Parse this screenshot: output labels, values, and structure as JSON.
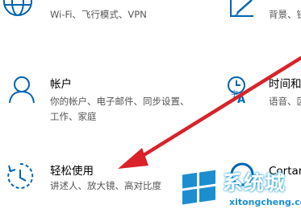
{
  "tiles": {
    "network": {
      "desc": "Wi-Fi、飞行模式、VPN",
      "icon": "globe-icon"
    },
    "personalization": {
      "desc": "背景、锁屏、颜",
      "icon": "pen-tablet-icon"
    },
    "accounts": {
      "title": "帐户",
      "desc_line1": "你的帐户、电子邮件、同步设置、",
      "desc_line2": "工作、家庭",
      "icon": "person-icon"
    },
    "time_language": {
      "title": "时间和",
      "desc": "语音、区域",
      "icon": "time-language-icon"
    },
    "ease_of_access": {
      "title": "轻松使用",
      "desc": "讲述人、放大镜、高对比度",
      "icon": "ease-of-access-icon"
    },
    "cortana": {
      "title": "Cortan",
      "icon": "cortana-icon"
    }
  },
  "watermark": {
    "text": "系统城",
    "url": "xitongcheng.com",
    "icon": "windows-logo-icon"
  },
  "colors": {
    "accent": "#0063b1",
    "arrow": "#d9222a",
    "watermark_blue": "#1c8ed0"
  }
}
